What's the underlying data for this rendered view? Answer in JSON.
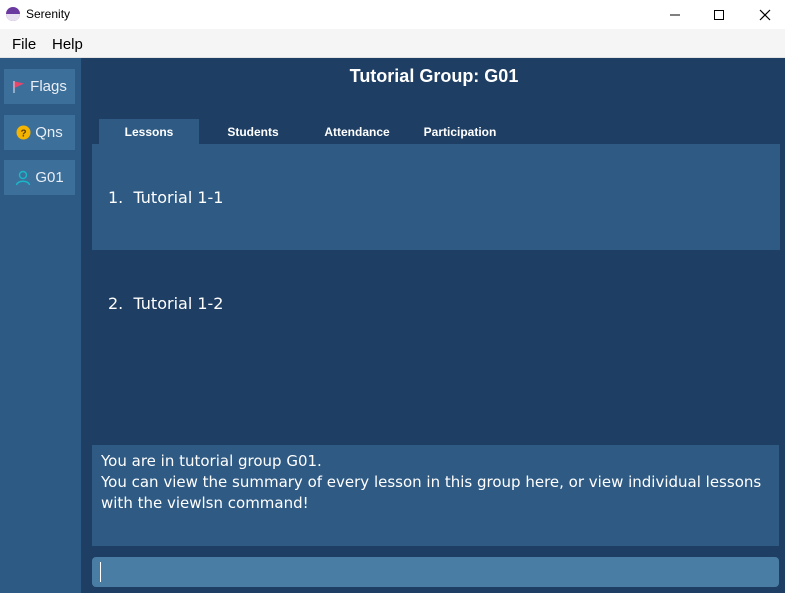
{
  "window": {
    "title": "Serenity",
    "controls": [
      "minimize-icon",
      "maximize-icon",
      "close-icon"
    ]
  },
  "menu": {
    "file": "File",
    "help": "Help"
  },
  "sidebar": {
    "items": [
      {
        "label": "Flags",
        "icon": "flag-icon",
        "icon_color": "#e9456a"
      },
      {
        "label": "Qns",
        "icon": "question-icon",
        "icon_color": "#f4b400"
      },
      {
        "label": "G01",
        "icon": "person-icon",
        "icon_color": "#19b7c8"
      }
    ]
  },
  "main": {
    "title": "Tutorial Group: G01",
    "tabs": [
      "Lessons",
      "Students",
      "Attendance",
      "Participation"
    ],
    "active_tab": "Lessons",
    "lessons": [
      {
        "index": "1.",
        "name": "Tutorial 1-1"
      },
      {
        "index": "2.",
        "name": "Tutorial 1-2"
      }
    ]
  },
  "result": {
    "line1": "You are in tutorial group G01.",
    "line2": "You can view the summary of every lesson in this group here, or view individual lessons with the viewlsn command!"
  },
  "command": {
    "value": ""
  },
  "colors": {
    "background": "#1e3e63",
    "panel": "#2e5a84",
    "sidebar": "#2d5a84",
    "sidebar_button": "#3c6f99",
    "command_box": "#4a7da4"
  }
}
